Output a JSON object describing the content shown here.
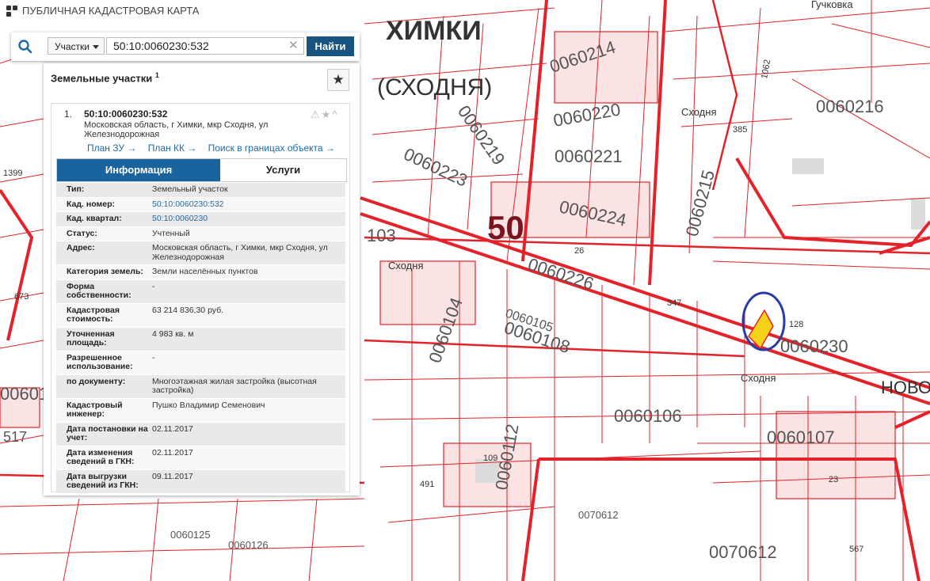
{
  "header": {
    "app_title": "ПУБЛИЧНАЯ КАДАСТРОВАЯ КАРТА"
  },
  "search": {
    "type_label": "Участки",
    "query": "50:10:0060230:532",
    "submit_label": "Найти"
  },
  "panel": {
    "title": "Земельные участки",
    "count": "1",
    "result": {
      "index": "1.",
      "cadastral_id": "50:10:0060230:532",
      "address": "Московская область, г Химки, мкр Сходня, ул Железнодорожная",
      "links": [
        "План ЗУ →",
        "План КК →",
        "Поиск в границах объекта →"
      ]
    },
    "tabs": [
      "Информация",
      "Услуги"
    ],
    "info": [
      {
        "label": "Тип:",
        "value": "Земельный участок"
      },
      {
        "label": "Кад. номер:",
        "value": "50:10:0060230:532"
      },
      {
        "label": "Кад. квартал:",
        "value": "50:10:0060230"
      },
      {
        "label": "Статус:",
        "value": "Учтенный"
      },
      {
        "label": "Адрес:",
        "value": "Московская область, г Химки, мкр Сходня, ул Железнодорожная"
      },
      {
        "label": "Категория земель:",
        "value": "Земли населённых пунктов"
      },
      {
        "label": "Форма собственности:",
        "value": "-"
      },
      {
        "label": "Кадастровая стоимость:",
        "value": "63 214 836,30 руб."
      },
      {
        "label": "Уточненная площадь:",
        "value": "4 983 кв. м"
      },
      {
        "label": "Разрешенное использование:",
        "value": "-"
      },
      {
        "label": "по документу:",
        "value": "Многоэтажная жилая застройка (высотная застройка)"
      },
      {
        "label": "Кадастровый инженер:",
        "value": "Пушко Владимир Семенович"
      },
      {
        "label": "Дата постановки на учет:",
        "value": "02.11.2017"
      },
      {
        "label": "Дата изменения сведений в ГКН:",
        "value": "02.11.2017"
      },
      {
        "label": "Дата выгрузки сведений из ГКН:",
        "value": "09.11.2017"
      }
    ]
  },
  "map": {
    "place_labels": [
      "ХИМКИ",
      "(СХОДНЯ)",
      "Сходня",
      "Сходня",
      "Сходня",
      "Гучковка",
      "НОВО"
    ],
    "region_code": "50",
    "quarter_labels": [
      "0060214",
      "0060216",
      "0060219",
      "0060220",
      "0060221",
      "0060223",
      "0060224",
      "0060215",
      "0060226",
      "0060105",
      "0060108",
      "0060104",
      "0060230",
      "0060106",
      "0060107",
      "0060112",
      "0070612",
      "0070612",
      "0060125",
      "0060126",
      "00601"
    ],
    "parcel_numbers": [
      "385",
      "103",
      "26",
      "347",
      "128",
      "1062",
      "1399",
      "673",
      "517",
      "567",
      "491",
      "109",
      "23"
    ],
    "colors": {
      "boundary": "#e4222a",
      "highlight_fill": "#f7d21a",
      "highlight_circle": "#2a3ba8",
      "background": "#ffffff"
    }
  }
}
